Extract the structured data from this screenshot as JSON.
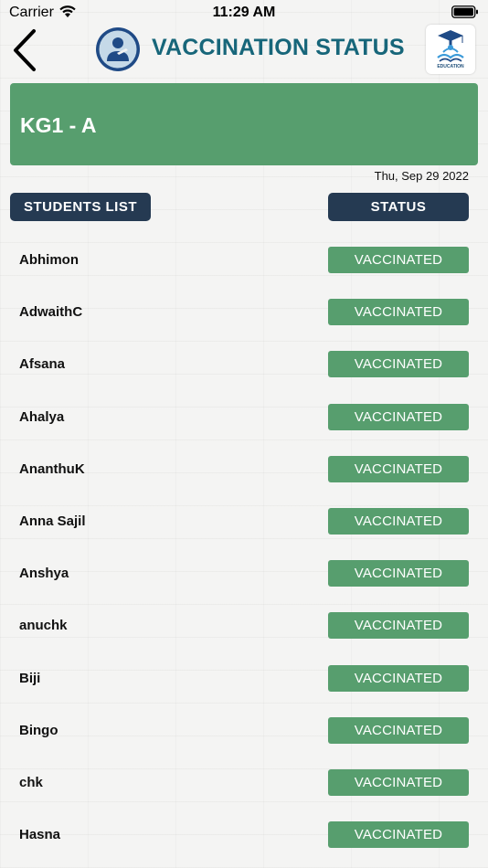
{
  "status_bar": {
    "carrier": "Carrier",
    "time": "11:29 AM"
  },
  "header": {
    "title": "VACCINATION STATUS",
    "back_icon": "chevron-left-icon",
    "logo_icon": "student-avatar-icon",
    "school_logo_caption": "EDUCATION"
  },
  "class_banner": {
    "name": "KG1 - A",
    "color": "#579e6e"
  },
  "date": "Thu, Sep 29 2022",
  "columns": {
    "students": "STUDENTS LIST",
    "status": "STATUS"
  },
  "colors": {
    "header_pill": "#253a52",
    "badge": "#579e6e",
    "title": "#17667a"
  },
  "students": [
    {
      "name": "Abhimon",
      "status": "VACCINATED"
    },
    {
      "name": "AdwaithC",
      "status": "VACCINATED"
    },
    {
      "name": "Afsana",
      "status": "VACCINATED"
    },
    {
      "name": "Ahalya",
      "status": "VACCINATED"
    },
    {
      "name": "AnanthuK",
      "status": "VACCINATED"
    },
    {
      "name": "Anna Sajil",
      "status": "VACCINATED"
    },
    {
      "name": "Anshya",
      "status": "VACCINATED"
    },
    {
      "name": "anuchk",
      "status": "VACCINATED"
    },
    {
      "name": "Biji",
      "status": "VACCINATED"
    },
    {
      "name": "Bingo",
      "status": "VACCINATED"
    },
    {
      "name": "chk",
      "status": "VACCINATED"
    },
    {
      "name": "Hasna",
      "status": "VACCINATED"
    }
  ]
}
